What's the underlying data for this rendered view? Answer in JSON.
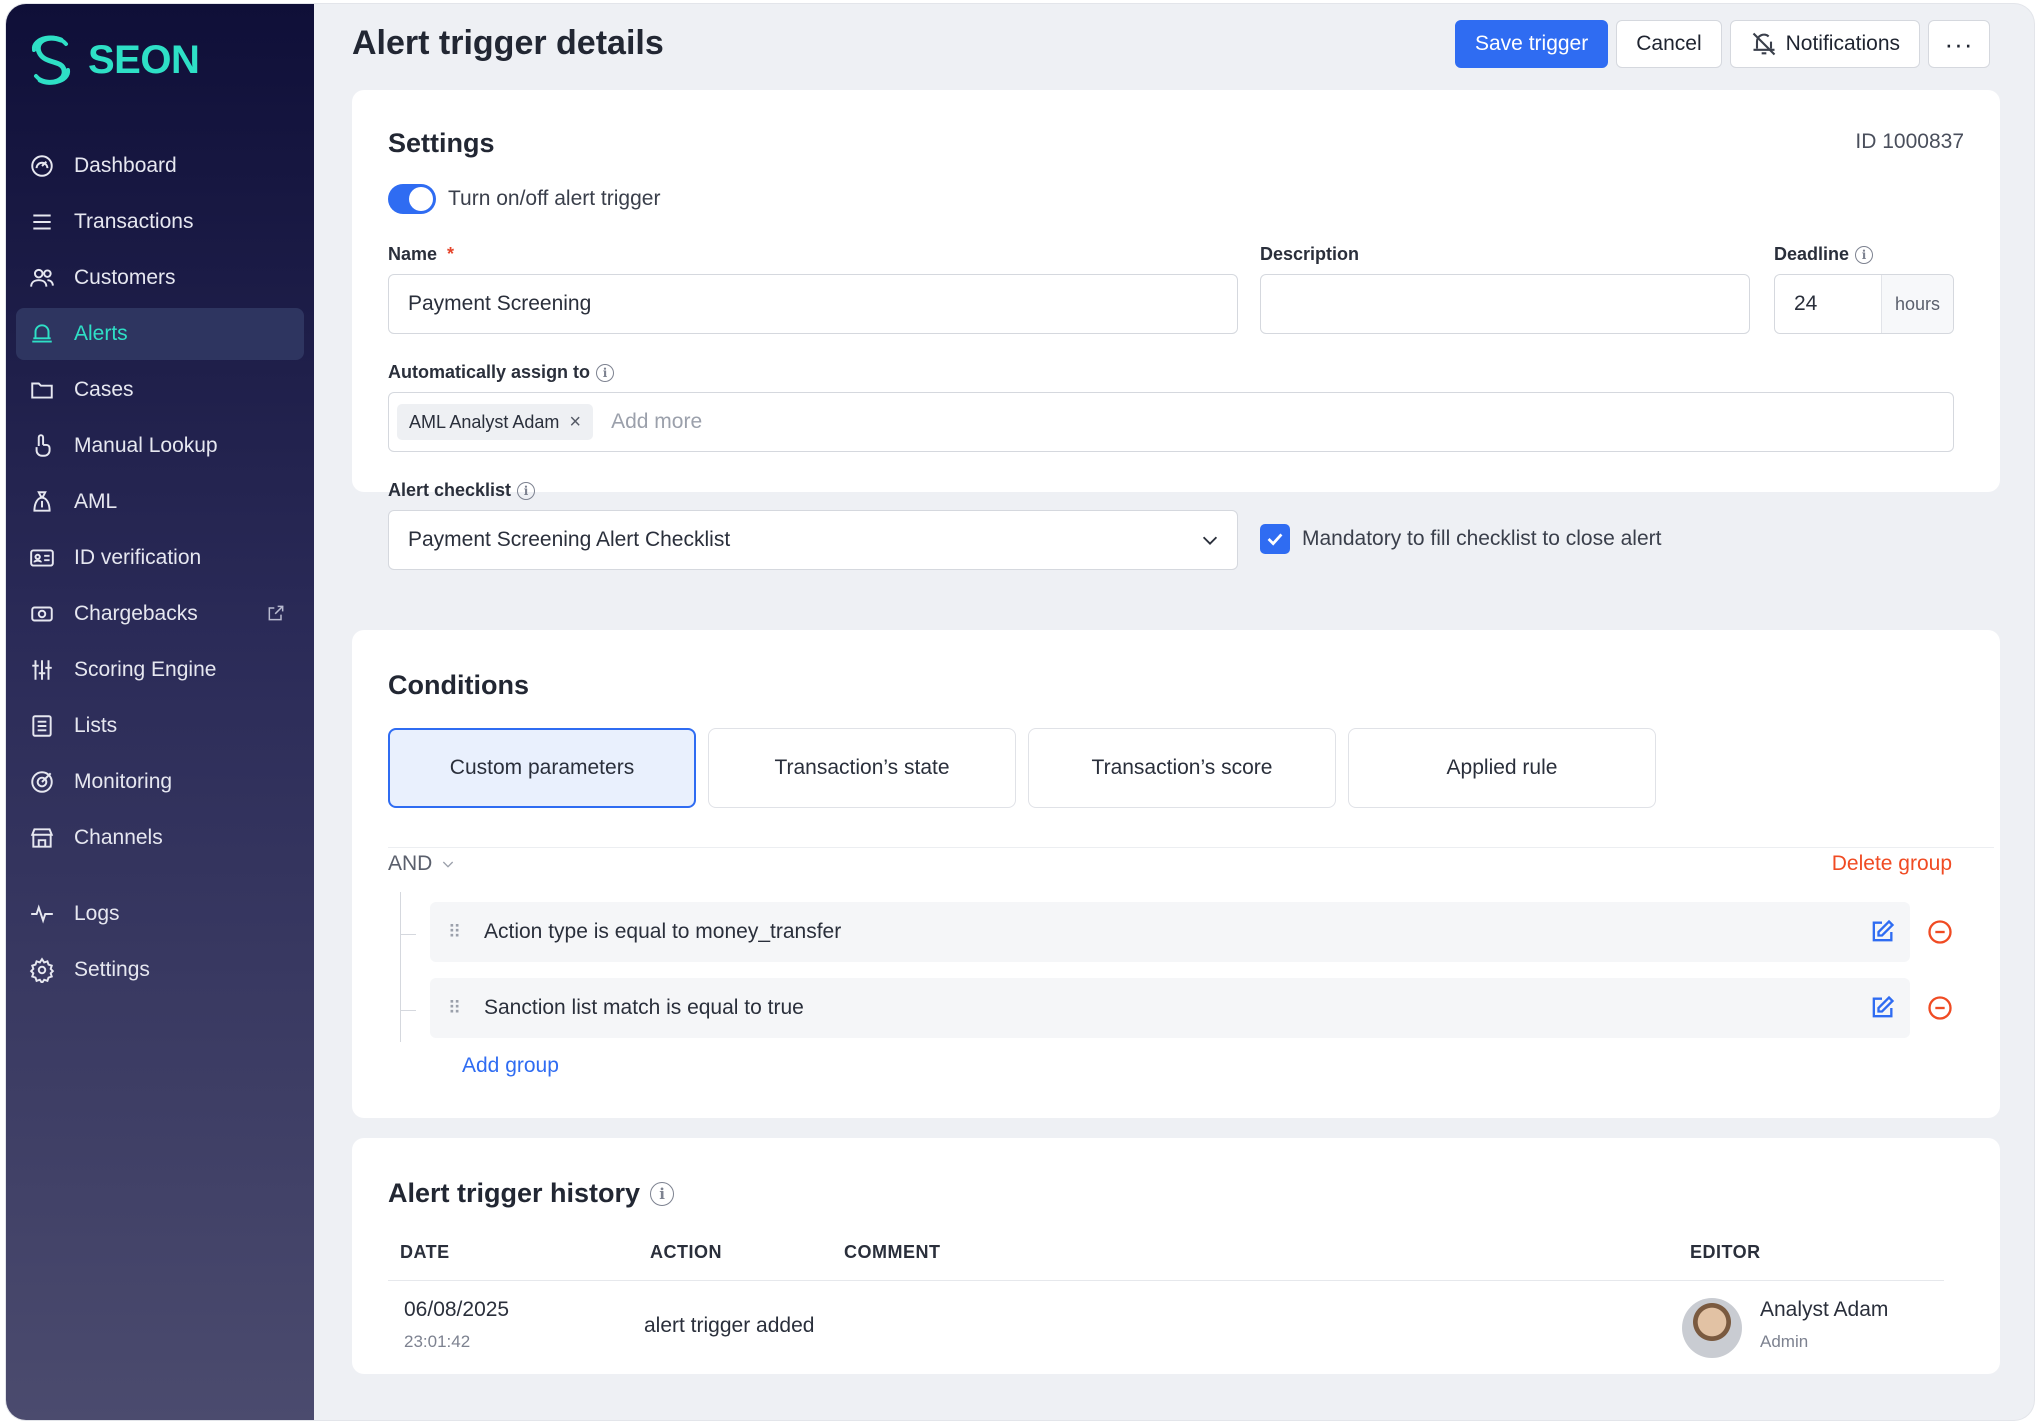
{
  "brand": {
    "name": "SEON",
    "color": "#2ee0c6"
  },
  "sidebar": {
    "items": [
      {
        "label": "Dashboard",
        "icon": "dashboard-icon"
      },
      {
        "label": "Transactions",
        "icon": "menu-lines-icon"
      },
      {
        "label": "Customers",
        "icon": "users-icon"
      },
      {
        "label": "Alerts",
        "icon": "alert-bell-icon",
        "active": true
      },
      {
        "label": "Cases",
        "icon": "folder-icon"
      },
      {
        "label": "Manual Lookup",
        "icon": "pointer-hand-icon"
      },
      {
        "label": "AML",
        "icon": "money-bag-icon"
      },
      {
        "label": "ID verification",
        "icon": "id-card-icon"
      },
      {
        "label": "Chargebacks",
        "icon": "cash-icon",
        "external": true
      },
      {
        "label": "Scoring Engine",
        "icon": "sliders-icon"
      },
      {
        "label": "Lists",
        "icon": "list-icon"
      },
      {
        "label": "Monitoring",
        "icon": "target-icon"
      },
      {
        "label": "Channels",
        "icon": "storefront-icon"
      },
      {
        "label": "Logs",
        "icon": "pulse-icon"
      },
      {
        "label": "Settings",
        "icon": "gear-icon"
      }
    ]
  },
  "header": {
    "title": "Alert trigger details",
    "save_label": "Save trigger",
    "cancel_label": "Cancel",
    "notifications_label": "Notifications",
    "more_label": "···"
  },
  "settings": {
    "title": "Settings",
    "id_label": "ID 1000837",
    "toggle_label": "Turn on/off alert trigger",
    "toggle_on": true,
    "name_label": "Name",
    "name_required": "*",
    "name_value": "Payment Screening",
    "description_label": "Description",
    "description_value": "",
    "deadline_label": "Deadline",
    "deadline_value": "24",
    "deadline_unit": "hours",
    "assign_label": "Automatically assign to",
    "assignee_chip": "AML Analyst Adam",
    "chip_remove": "×",
    "assign_placeholder": "Add more",
    "checklist_label": "Alert checklist",
    "checklist_value": "Payment Screening Alert Checklist",
    "mandatory_label": "Mandatory to fill checklist to close alert",
    "mandatory_checked": true
  },
  "conditions": {
    "title": "Conditions",
    "tabs": [
      "Custom parameters",
      "Transaction’s state",
      "Transaction’s score",
      "Applied rule"
    ],
    "active_tab": 0,
    "operator": "AND",
    "delete_group_label": "Delete group",
    "rows": [
      "Action type is equal to money_transfer",
      "Sanction list match is equal to true"
    ],
    "add_group_label": "Add group"
  },
  "history": {
    "title": "Alert trigger history",
    "columns": [
      "DATE",
      "ACTION",
      "COMMENT",
      "EDITOR"
    ],
    "rows": [
      {
        "date": "06/08/2025",
        "time": "23:01:42",
        "action": "alert trigger added",
        "comment": "",
        "editor_name": "Analyst Adam",
        "editor_role": "Admin"
      }
    ]
  },
  "colors": {
    "accent": "#2f6cf2",
    "danger": "#f04b23",
    "sidebar_top": "#0f0f38"
  }
}
